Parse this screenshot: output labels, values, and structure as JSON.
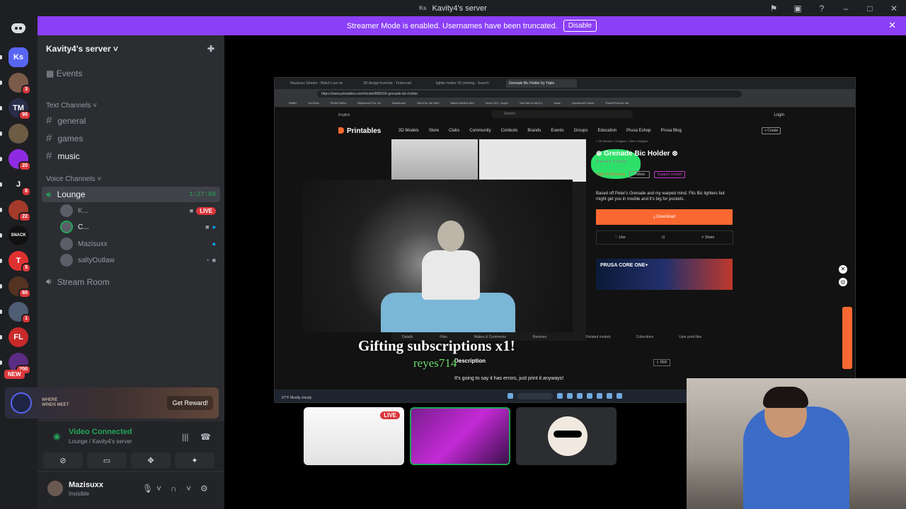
{
  "window": {
    "title": "Kavity4's server",
    "badge": "Ks"
  },
  "titlebar_icons": [
    "inbox-flag-icon",
    "screen-share-icon",
    "help-icon",
    "minimize-icon",
    "maximize-icon",
    "close-icon"
  ],
  "banner": {
    "text": "Streamer Mode is enabled. Usernames have been truncated.",
    "button": "Disable",
    "color": "#8b3ff7"
  },
  "guilds": [
    {
      "label": "Ks",
      "color": "#5865f2",
      "badge": ""
    },
    {
      "label": "",
      "color": "#7a5b4a",
      "badge": "3"
    },
    {
      "label": "TM",
      "color": "#2a2d4a",
      "badge": "95"
    },
    {
      "label": "",
      "color": "#6d5b44",
      "badge": ""
    },
    {
      "label": "",
      "color": "#8e2be2",
      "badge": "20"
    },
    {
      "label": "J",
      "color": "#1e1f22",
      "badge": "8"
    },
    {
      "label": "",
      "color": "#a33a2a",
      "badge": "22"
    },
    {
      "label": "SNACK",
      "color": "#111111",
      "badge": ""
    },
    {
      "label": "T",
      "color": "#e03131",
      "badge": "5"
    },
    {
      "label": "",
      "color": "#553322",
      "badge": "60"
    },
    {
      "label": "",
      "color": "#4f5d75",
      "badge": "1"
    },
    {
      "label": "FL",
      "color": "#c92a2a",
      "badge": ""
    },
    {
      "label": "",
      "color": "#5b2c83",
      "badge": "200"
    }
  ],
  "new_badge": "NEW",
  "server": {
    "name": "Kavity4's server ˅",
    "events": "Events",
    "text_category": "Text Channels ˅",
    "text_channels": [
      "general",
      "games",
      "music"
    ],
    "voice_category": "Voice Channels ˅",
    "lounge": {
      "name": "Lounge",
      "timer": "1:27:08"
    },
    "voice_users": [
      {
        "name": "K...",
        "live": "LIVE"
      },
      {
        "name": "C..."
      },
      {
        "name": "Mazisuxx"
      },
      {
        "name": "saltyOutlaw"
      }
    ],
    "stream_room": "Stream Room"
  },
  "promo": {
    "line1": "WHERE",
    "line2": "WINDS MEET",
    "button": "Get Reward!"
  },
  "voice_panel": {
    "title": "Video Connected",
    "subtitle": "Lounge / Kavity4's server"
  },
  "user": {
    "name": "Mazisuxx",
    "status": "Invisible"
  },
  "browser": {
    "tabs": [
      "Mazisuxx Stream - Watch Live on",
      "3D design frenchie - Tinkercad",
      "lighter holder 3D printing - Search",
      "Grenade Bic Holder by Triple"
    ],
    "url": "https://www.printables.com/model/808165-grenade-bic-holder",
    "bookmarks": [
      "Netflix",
      "YouTube",
      "PicArt Editor",
      "MyMenced For Us",
      "Dashboard",
      "Word for the Web",
      "Watch Movies Stre",
      "Inbox (10) - kagvil",
      "YouTube to Mp3 C",
      "trade",
      "QuestionAI Home",
      "PowerPoint for the"
    ]
  },
  "printables": {
    "language": "English",
    "search": "Search",
    "login": "Login",
    "logo": "Printables",
    "nav": [
      "3D Models",
      "Store",
      "Clubs",
      "Community",
      "Contests",
      "Brands",
      "Events",
      "Groups",
      "Education",
      "Prusa Eshop",
      "Prusa Blog"
    ],
    "create": "+ Create",
    "breadcrumb": "< 3D Models  < Gadgets  < Other Gadgets",
    "title": "⊗ Grenade Bic Holder ⊗",
    "stars": "★★★★★ 4 ratings",
    "author": "Triple G Workshop",
    "follow": "Follow",
    "support": "Support creator",
    "description": "Based off Peter's Grenade and my warped mind. Fits Bic lighters but might get you in trouble and it's big for pockets.",
    "download": "⤓ Download",
    "actions": [
      "♡ Like",
      "⊡",
      "⇗ Share"
    ],
    "ad": "PRUSA CORE ONE+",
    "tabs": [
      "Details",
      "Files",
      "Makes & Comments",
      "Remixes"
    ],
    "related": [
      "Related models",
      "Collections",
      "User print files"
    ],
    "desc_heading": "Description",
    "quote": "It's going to say it has errors, just print it anyways!",
    "pdf": "⇩ PDF",
    "weather": "67°F Mostly cloudy",
    "taskbar_search": "Search"
  },
  "overlay": {
    "gift": "Gifting subscriptions x1!",
    "user": "reyes714"
  },
  "tiles": [
    {
      "live": "LIVE"
    },
    {},
    {}
  ]
}
